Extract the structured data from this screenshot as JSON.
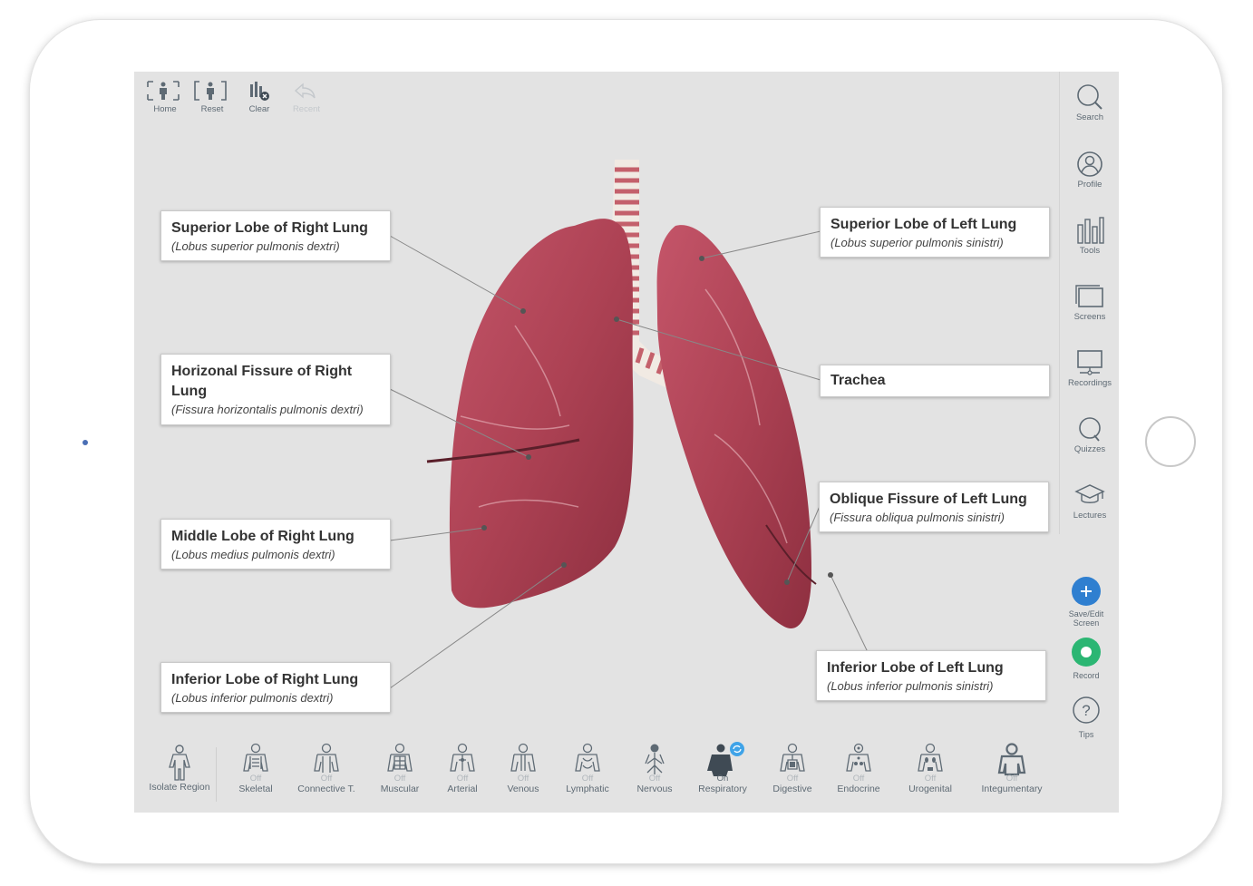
{
  "toolbar": {
    "home": "Home",
    "reset": "Reset",
    "clear": "Clear",
    "recent": "Recent"
  },
  "sidebar": {
    "search": "Search",
    "profile": "Profile",
    "tools": "Tools",
    "screens": "Screens",
    "recordings": "Recordings",
    "quizzes": "Quizzes",
    "lectures": "Lectures",
    "save_edit": "Save/Edit Screen",
    "record": "Record",
    "tips": "Tips"
  },
  "labels": {
    "sup_right": {
      "name": "Superior Lobe of Right Lung",
      "latin": "(Lobus superior pulmonis dextri)"
    },
    "hfiss_right": {
      "name": "Horizonal Fissure of Right Lung",
      "latin": "(Fissura horizontalis pulmonis dextri)"
    },
    "mid_right": {
      "name": "Middle Lobe of Right Lung",
      "latin": "(Lobus medius pulmonis dextri)"
    },
    "inf_right": {
      "name": "Inferior Lobe of Right Lung",
      "latin": "(Lobus inferior pulmonis dextri)"
    },
    "sup_left": {
      "name": "Superior Lobe of Left Lung",
      "latin": "(Lobus superior pulmonis sinistri)"
    },
    "trachea": {
      "name": "Trachea"
    },
    "ofiss_left": {
      "name": "Oblique Fissure of Left Lung",
      "latin": "(Fissura obliqua pulmonis sinistri)"
    },
    "inf_left": {
      "name": "Inferior Lobe of Left Lung",
      "latin": "(Lobus inferior pulmonis sinistri)"
    }
  },
  "systems": {
    "isolate": {
      "label": "Isolate Region"
    },
    "skeletal": {
      "label": "Skeletal",
      "state": "Off"
    },
    "connective": {
      "label": "Connective T.",
      "state": "Off"
    },
    "muscular": {
      "label": "Muscular",
      "state": "Off"
    },
    "arterial": {
      "label": "Arterial",
      "state": "Off"
    },
    "venous": {
      "label": "Venous",
      "state": "Off"
    },
    "lymphatic": {
      "label": "Lymphatic",
      "state": "Off"
    },
    "nervous": {
      "label": "Nervous",
      "state": "Off"
    },
    "respiratory": {
      "label": "Respiratory",
      "state": "On"
    },
    "digestive": {
      "label": "Digestive",
      "state": "Off"
    },
    "endocrine": {
      "label": "Endocrine",
      "state": "Off"
    },
    "urogenital": {
      "label": "Urogenital",
      "state": "Off"
    },
    "integumentary": {
      "label": "Integumentary",
      "state": "Off"
    }
  },
  "colors": {
    "accent_blue": "#2f7fd0",
    "record_green": "#2bb673",
    "lung": "#b2475a",
    "trachea_ring": "#c4606b"
  }
}
